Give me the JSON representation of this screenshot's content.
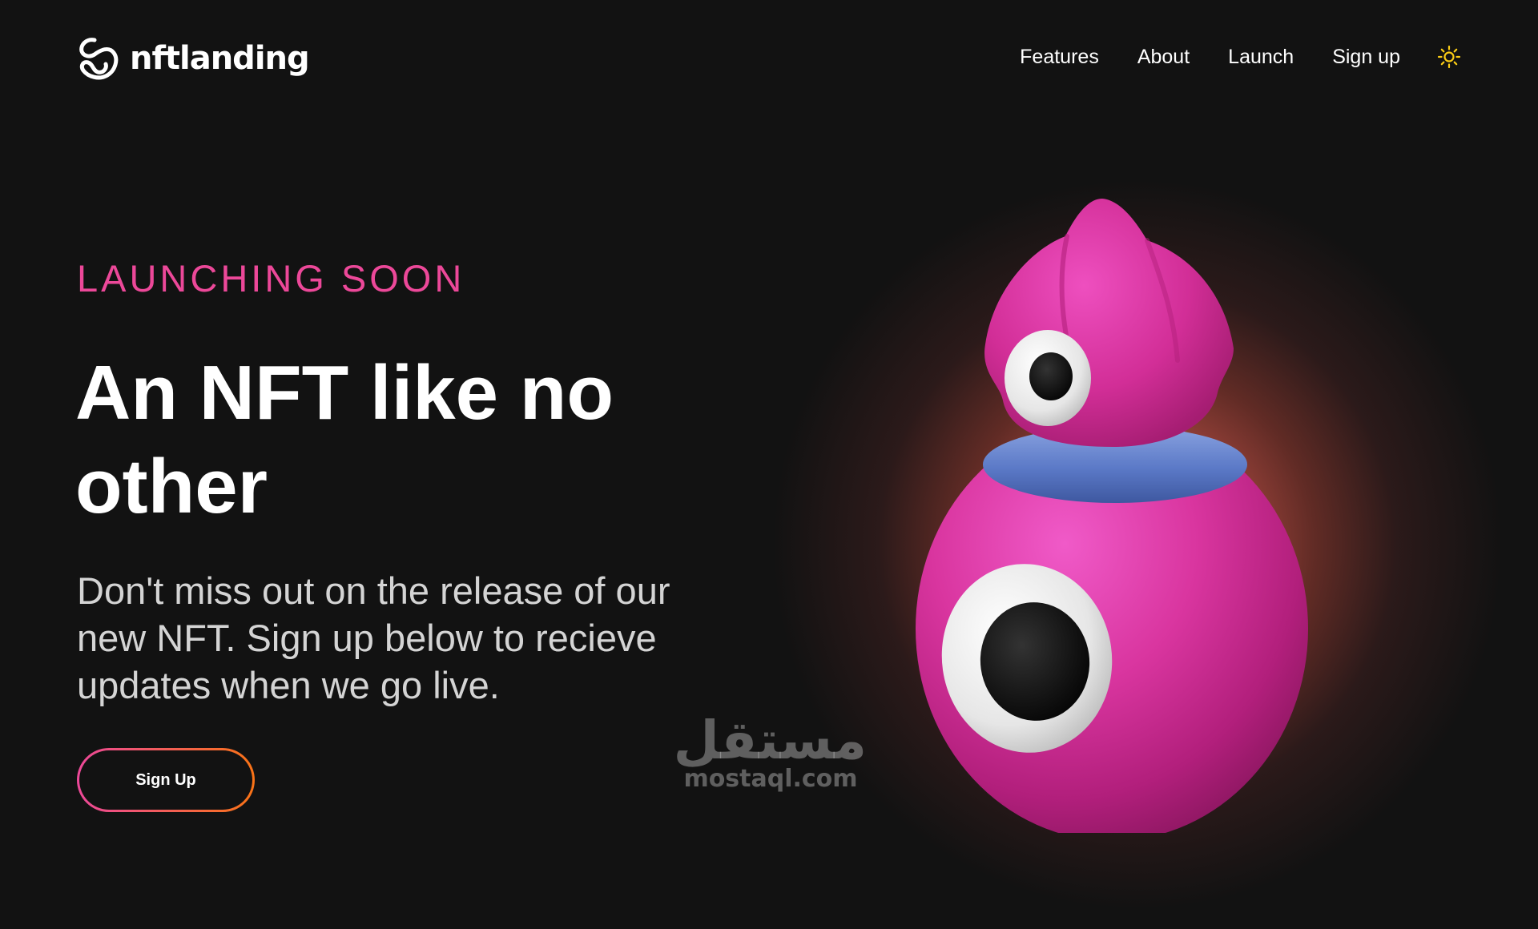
{
  "header": {
    "logo": {
      "icon": "swirl-logo-icon",
      "text": "nftlanding"
    },
    "nav": {
      "items": [
        {
          "label": "Features"
        },
        {
          "label": "About"
        },
        {
          "label": "Launch"
        },
        {
          "label": "Sign up"
        }
      ],
      "theme_toggle_icon": "sun-icon"
    }
  },
  "hero": {
    "eyebrow": "LAUNCHING SOON",
    "headline": "An NFT like no other",
    "description": "Don't miss out on the release of our new NFT. Sign up below to recieve updates when we go live.",
    "cta_label": "Sign Up",
    "image": "pink-monster-character"
  },
  "watermark": {
    "arabic": "مستقل",
    "latin": "mostaql.com"
  },
  "colors": {
    "background": "#121212",
    "accent_pink": "#ec4899",
    "accent_orange": "#f97316",
    "sun_icon": "#facc15",
    "text_muted": "#d4d4d4"
  }
}
